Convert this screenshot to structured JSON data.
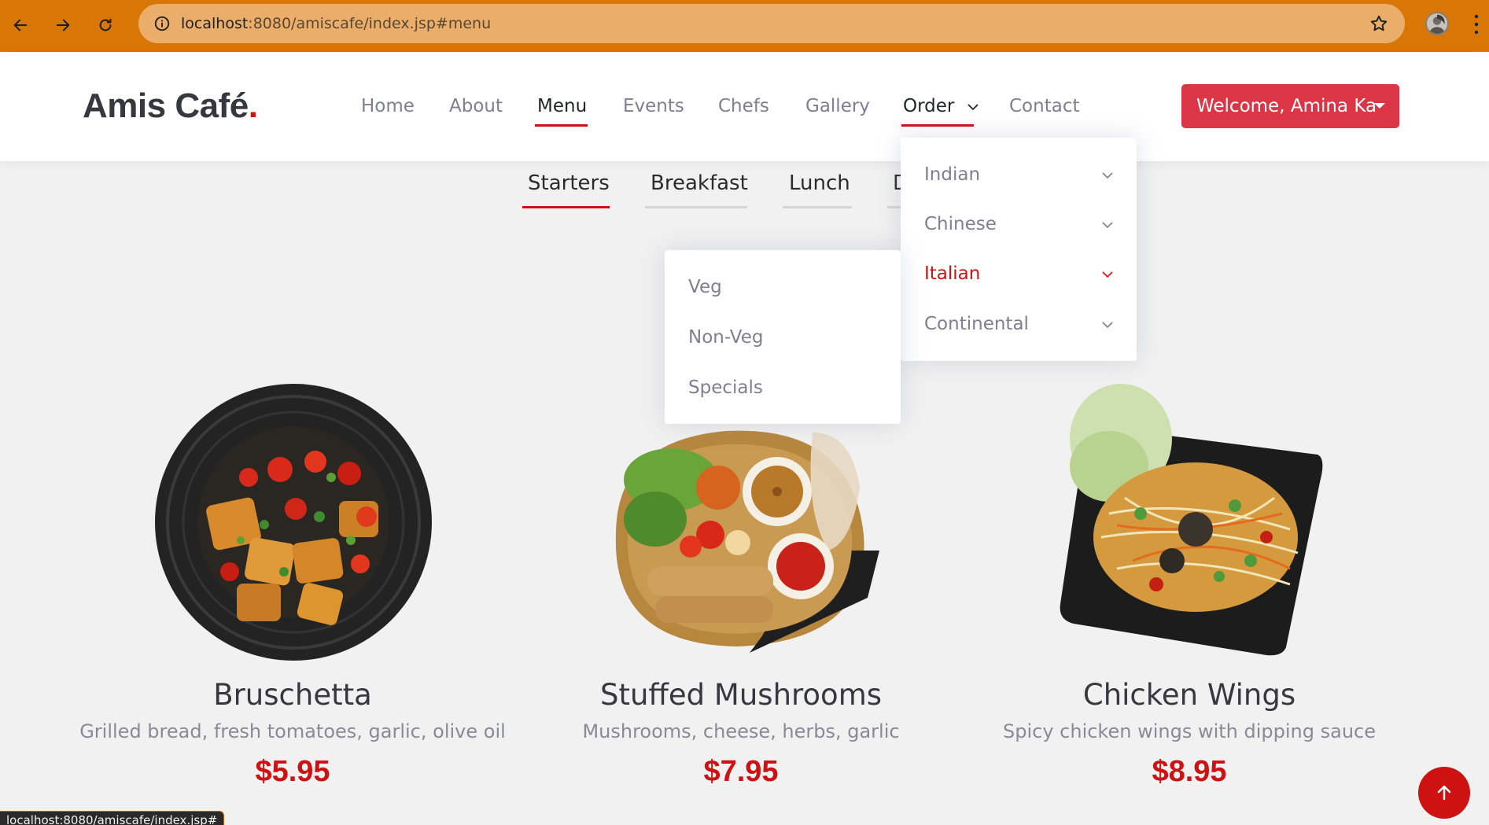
{
  "browser": {
    "url_host": "localhost",
    "url_rest": ":8080/amiscafe/index.jsp#menu",
    "status_url": "localhost:8080/amiscafe/index.jsp#"
  },
  "site": {
    "logo_text": "Amis Café",
    "logo_dot": ".",
    "accent_color": "#ce1212"
  },
  "nav": {
    "home": "Home",
    "about": "About",
    "menu": "Menu",
    "events": "Events",
    "chefs": "Chefs",
    "gallery": "Gallery",
    "order": "Order",
    "contact": "Contact",
    "welcome": "Welcome, Amina Ka"
  },
  "menu_tabs": {
    "starters": "Starters",
    "breakfast": "Breakfast",
    "lunch": "Lunch",
    "dinner_partial": "D"
  },
  "order_dropdown": {
    "items": [
      {
        "label": "Indian"
      },
      {
        "label": "Chinese"
      },
      {
        "label": "Italian"
      },
      {
        "label": "Continental"
      }
    ]
  },
  "sub_dropdown": {
    "items": [
      {
        "label": "Veg"
      },
      {
        "label": "Non-Veg"
      },
      {
        "label": "Specials"
      }
    ]
  },
  "cards": [
    {
      "title": "Bruschetta",
      "desc": "Grilled bread, fresh tomatoes, garlic, olive oil",
      "price": "$5.95"
    },
    {
      "title": "Stuffed Mushrooms",
      "desc": "Mushrooms, cheese, herbs, garlic",
      "price": "$7.95"
    },
    {
      "title": "Chicken Wings",
      "desc": "Spicy chicken wings with dipping sauce",
      "price": "$8.95"
    }
  ]
}
